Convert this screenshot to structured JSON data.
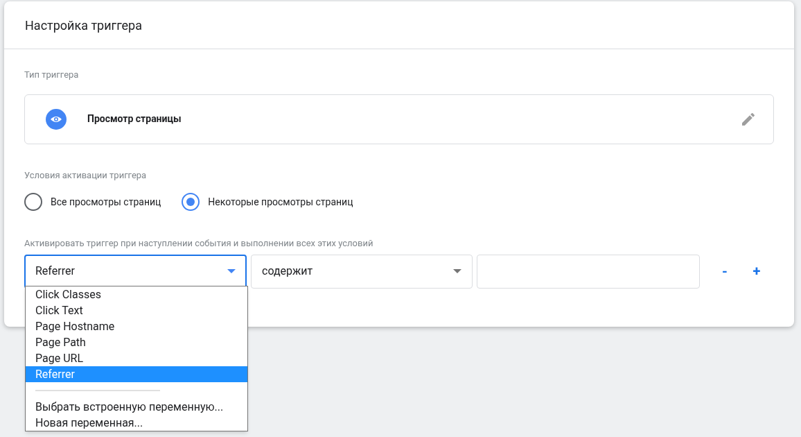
{
  "title": "Настройка триггера",
  "trigger_type": {
    "label": "Тип триггера",
    "name": "Просмотр страницы"
  },
  "activation": {
    "label": "Условия активации триггера",
    "options": [
      {
        "label": "Все просмотры страниц",
        "selected": false
      },
      {
        "label": "Некоторые просмотры страниц",
        "selected": true
      }
    ]
  },
  "condition": {
    "label": "Активировать триггер при наступлении события и выполнении всех этих условий",
    "variable": "Referrer",
    "operator": "содержит",
    "remove": "-",
    "add": "+"
  },
  "dropdown": {
    "items": [
      {
        "label": "Click Classes",
        "selected": false
      },
      {
        "label": "Click Text",
        "selected": false
      },
      {
        "label": "Page Hostname",
        "selected": false
      },
      {
        "label": "Page Path",
        "selected": false
      },
      {
        "label": "Page URL",
        "selected": false
      },
      {
        "label": "Referrer",
        "selected": true
      }
    ],
    "extra": [
      "Выбрать встроенную переменную...",
      "Новая переменная..."
    ]
  }
}
